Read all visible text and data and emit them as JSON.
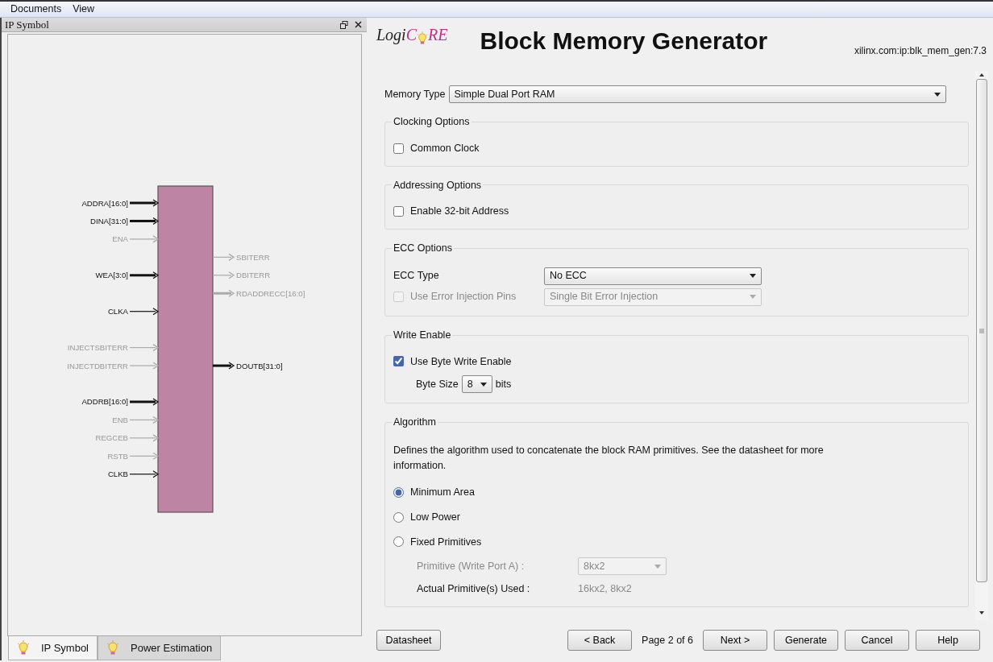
{
  "menu": [
    {
      "label": "Documents"
    },
    {
      "label": "View"
    }
  ],
  "left_panel": {
    "title": "IP Symbol",
    "symbol": {
      "left_groups": [
        [
          {
            "label": "ADDRA[16:0]",
            "enabled": true,
            "bus": true
          },
          {
            "label": "DINA[31:0]",
            "enabled": true,
            "bus": true
          },
          {
            "label": "ENA",
            "enabled": false,
            "bus": false
          }
        ],
        [
          {
            "label": "WEA[3:0]",
            "enabled": true,
            "bus": true
          }
        ],
        [
          {
            "label": "CLKA",
            "enabled": true,
            "bus": false
          }
        ],
        [
          {
            "label": "INJECTSBITERR",
            "enabled": false,
            "bus": false
          },
          {
            "label": "INJECTDBITERR",
            "enabled": false,
            "bus": false
          }
        ],
        [
          {
            "label": "ADDRB[16:0]",
            "enabled": true,
            "bus": true
          },
          {
            "label": "ENB",
            "enabled": false,
            "bus": false
          },
          {
            "label": "REGCEB",
            "enabled": false,
            "bus": false
          },
          {
            "label": "RSTB",
            "enabled": false,
            "bus": false
          },
          {
            "label": "CLKB",
            "enabled": true,
            "bus": false
          }
        ]
      ],
      "right_groups": [
        [
          {
            "label": "SBITERR",
            "enabled": false,
            "bus": false
          },
          {
            "label": "DBITERR",
            "enabled": false,
            "bus": false
          },
          {
            "label": "RDADDRECC[16:0]",
            "enabled": false,
            "bus": true
          }
        ],
        [
          {
            "label": "DOUTB[31:0]",
            "enabled": true,
            "bus": true
          }
        ]
      ]
    }
  },
  "bottom_tabs": [
    {
      "label": "IP Symbol",
      "selected": true
    },
    {
      "label": "Power Estimation",
      "selected": false
    }
  ],
  "header": {
    "logo_parts": [
      "Logi",
      "C",
      "RE"
    ],
    "title": "Block Memory Generator",
    "version": "xilinx.com:ip:blk_mem_gen:7.3"
  },
  "memory_type": {
    "label": "Memory Type",
    "value": "Simple Dual Port RAM"
  },
  "groups": [
    {
      "title": "Clocking Options",
      "items": [
        {
          "kind": "checkbox",
          "label": "Common Clock",
          "checked": false,
          "disabled": false
        }
      ]
    },
    {
      "title": "Addressing Options",
      "items": [
        {
          "kind": "checkbox",
          "label": "Enable 32-bit Address",
          "checked": false,
          "disabled": false
        }
      ]
    },
    {
      "title": "ECC Options",
      "items": [
        {
          "kind": "select",
          "label": "ECC Type",
          "value": "No ECC",
          "disabled": false
        },
        {
          "kind": "checkbox_select",
          "label": "Use Error Injection Pins",
          "checked": false,
          "value": "Single Bit Error Injection",
          "disabled": true
        }
      ]
    },
    {
      "title": "Write Enable",
      "items": [
        {
          "kind": "checkbox",
          "label": "Use Byte Write Enable",
          "checked": true,
          "disabled": false
        },
        {
          "kind": "inline_select",
          "label": "Byte Size",
          "value": "8",
          "unit": "bits",
          "disabled": false
        }
      ]
    },
    {
      "title": "Algorithm",
      "items": [
        {
          "kind": "text",
          "label": "Defines the algorithm used to concatenate the block RAM primitives.  See the datasheet for more information."
        },
        {
          "kind": "radio",
          "label": "Minimum Area",
          "selected": true
        },
        {
          "kind": "radio",
          "label": "Low Power",
          "selected": false
        },
        {
          "kind": "radio",
          "label": "Fixed Primitives",
          "selected": false
        },
        {
          "kind": "sub_select",
          "label": "Primitive (Write Port A) :",
          "value": "8kx2",
          "disabled": true
        },
        {
          "kind": "sub_info",
          "label": "Actual Primitive(s) Used :",
          "value": "16kx2, 8kx2"
        }
      ]
    }
  ],
  "footer": {
    "left_button": "Datasheet",
    "items": [
      {
        "kind": "button",
        "label": "< Back"
      },
      {
        "kind": "text",
        "label": "Page 2 of 6"
      },
      {
        "kind": "button",
        "label": "Next >"
      },
      {
        "kind": "button",
        "label": "Generate"
      },
      {
        "kind": "button",
        "label": "Cancel"
      },
      {
        "kind": "button",
        "label": "Help"
      }
    ]
  }
}
